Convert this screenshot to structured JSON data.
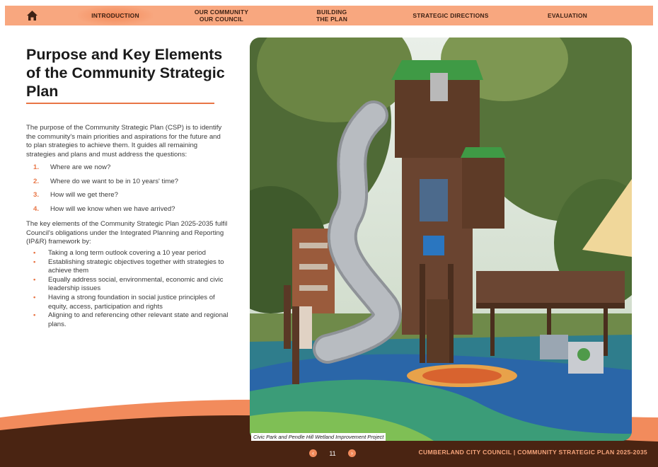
{
  "nav": {
    "items": [
      {
        "label": "INTRODUCTION"
      },
      {
        "label": "OUR COMMUNITY\nOUR COUNCIL"
      },
      {
        "label": "BUILDING\nTHE PLAN"
      },
      {
        "label": "STRATEGIC DIRECTIONS"
      },
      {
        "label": "EVALUATION"
      }
    ]
  },
  "page": {
    "title": "Purpose and Key Elements of the Community Strategic Plan",
    "intro": "The purpose of the Community Strategic Plan (CSP) is to identify the community's main priorities and aspirations for the future and to plan strategies to achieve them. It guides all remaining strategies and plans and must address the questions:",
    "questions": [
      {
        "num": "1.",
        "text": "Where are we now?"
      },
      {
        "num": "2.",
        "text": "Where do we want to be in 10 years' time?"
      },
      {
        "num": "3.",
        "text": "How will we get there?"
      },
      {
        "num": "4.",
        "text": "How will we know when we have arrived?"
      }
    ],
    "elements_intro": "The key elements of the Community Strategic Plan 2025-2035 fulfil Council's obligations under the Integrated Planning and Reporting (IP&R) framework by:",
    "bullets": [
      "Taking a long term outlook covering a 10 year period",
      "Establishing strategic objectives together with strategies to achieve them",
      "Equally address social, environmental, economic and civic leadership issues",
      "Having a strong foundation in social justice principles of equity, access, participation and rights",
      "Aligning to and referencing other relevant state and regional plans."
    ]
  },
  "photo": {
    "caption": "Civic Park and Pendle Hill Wetland Improvement Project"
  },
  "footer": {
    "text": "CUMBERLAND CITY COUNCIL  |  COMMUNITY STRATEGIC PLAN 2025-2035",
    "page_number": "11",
    "prev": "‹",
    "next": "›"
  },
  "colors": {
    "accent": "#e87545",
    "nav_bg": "#f8a77f",
    "brown": "#4a2412"
  }
}
